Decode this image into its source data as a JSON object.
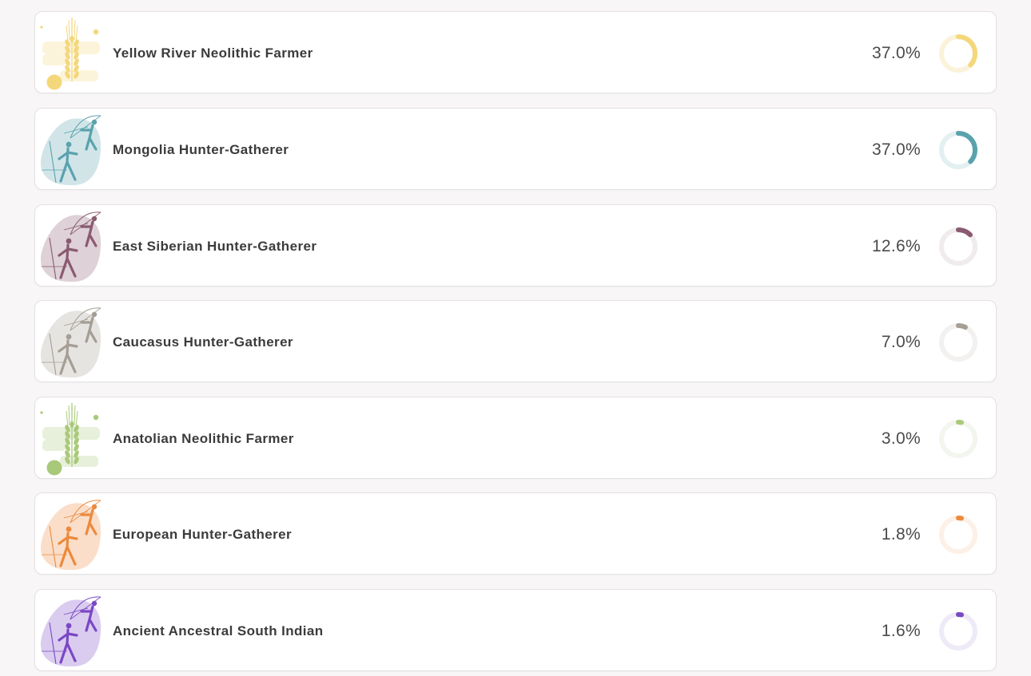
{
  "populations": [
    {
      "name": "Yellow River Neolithic Farmer",
      "percent_label": "37.0%",
      "share": 0.37,
      "color": "#f3d77a",
      "track": "#fbf3d9",
      "icon": "wheat-icon"
    },
    {
      "name": "Mongolia Hunter-Gatherer",
      "percent_label": "37.0%",
      "share": 0.37,
      "color": "#5aa3ad",
      "track": "#e3f0f2",
      "icon": "hunters-icon"
    },
    {
      "name": "East Siberian Hunter-Gatherer",
      "percent_label": "12.6%",
      "share": 0.126,
      "color": "#8a5a70",
      "track": "#f0ecee",
      "icon": "hunters-icon"
    },
    {
      "name": "Caucasus Hunter-Gatherer",
      "percent_label": "7.0%",
      "share": 0.07,
      "color": "#a49e94",
      "track": "#f2f1ef",
      "icon": "hunters-icon"
    },
    {
      "name": "Anatolian Neolithic Farmer",
      "percent_label": "3.0%",
      "share": 0.03,
      "color": "#a9c97a",
      "track": "#f3f6ee",
      "icon": "wheat-icon"
    },
    {
      "name": "European Hunter-Gatherer",
      "percent_label": "1.8%",
      "share": 0.018,
      "color": "#ec8a3d",
      "track": "#fdf0e6",
      "icon": "hunters-icon"
    },
    {
      "name": "Ancient Ancestral South Indian",
      "percent_label": "1.6%",
      "share": 0.016,
      "color": "#7a48c4",
      "track": "#efeaf7",
      "icon": "hunters-icon"
    }
  ]
}
